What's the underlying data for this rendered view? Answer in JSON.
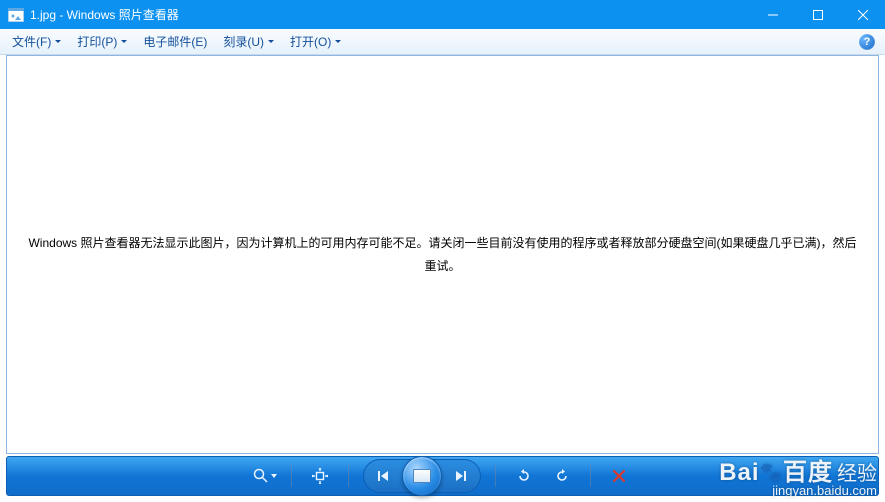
{
  "titlebar": {
    "title": "1.jpg - Windows 照片查看器"
  },
  "menubar": {
    "items": [
      {
        "label": "文件(F)"
      },
      {
        "label": "打印(P)"
      },
      {
        "label": "电子邮件(E)"
      },
      {
        "label": "刻录(U)"
      },
      {
        "label": "打开(O)"
      }
    ],
    "help": "?"
  },
  "content": {
    "message": "Windows 照片查看器无法显示此图片，因为计算机上的可用内存可能不足。请关闭一些目前没有使用的程序或者释放部分硬盘空间(如果硬盘几乎已满)，然后重试。"
  },
  "controls": {
    "zoom": "zoom",
    "fit": "fit",
    "prev": "previous",
    "slideshow": "slideshow",
    "next": "next",
    "rotate_ccw": "rotate-left",
    "rotate_cw": "rotate-right",
    "delete": "delete"
  },
  "watermark": {
    "brand_a": "Bai",
    "brand_b": "百度",
    "brand_c": "经验",
    "url": "jingyan.baidu.com"
  }
}
